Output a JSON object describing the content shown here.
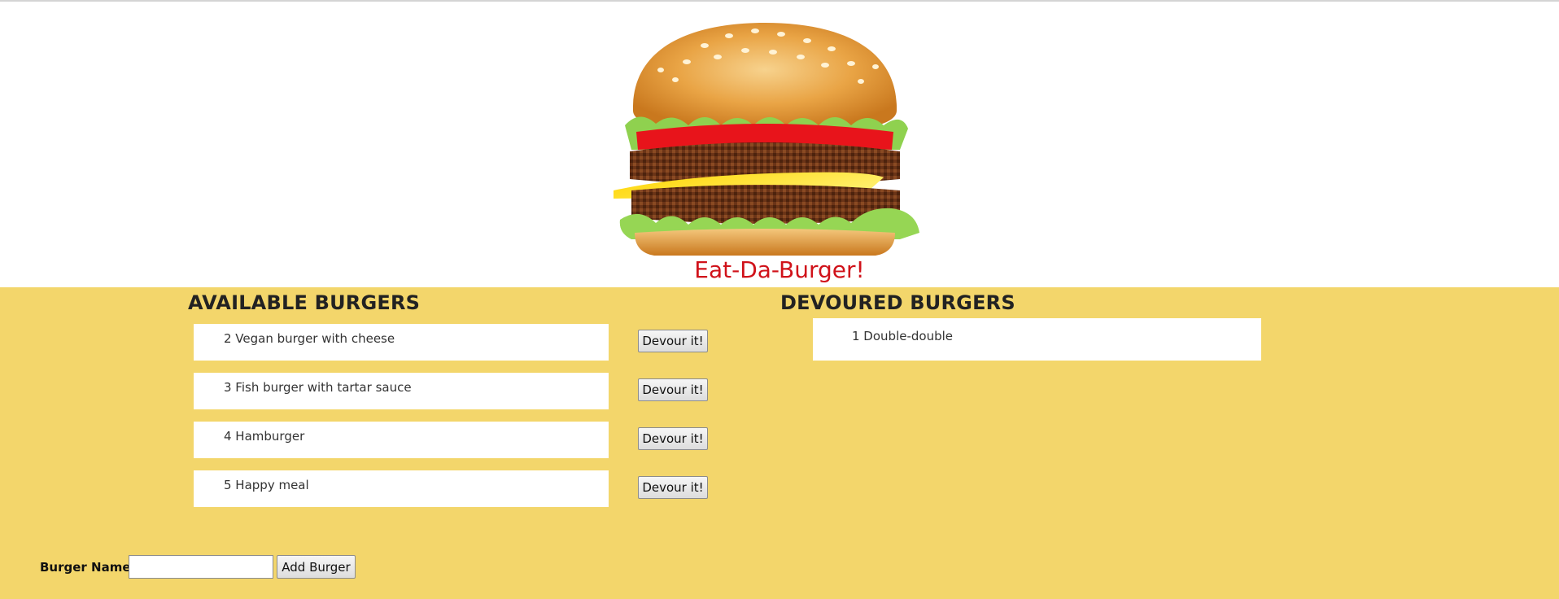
{
  "header": {
    "title": "Eat-Da-Burger!",
    "logo": "burger-image"
  },
  "available": {
    "heading": "AVAILABLE BURGERS",
    "button_label": "Devour it!",
    "items": [
      {
        "text": "2 Vegan burger with cheese"
      },
      {
        "text": "3 Fish burger with tartar sauce"
      },
      {
        "text": "4 Hamburger"
      },
      {
        "text": "5 Happy meal"
      }
    ]
  },
  "devoured": {
    "heading": "DEVOURED BURGERS",
    "items": [
      {
        "text": "1 Double-double"
      }
    ]
  },
  "form": {
    "label": "Burger Name:",
    "input_value": "",
    "submit_label": "Add Burger"
  },
  "colors": {
    "title": "#d0121a",
    "panel_bg": "#f3d66b",
    "item_bg": "#ffffff"
  }
}
